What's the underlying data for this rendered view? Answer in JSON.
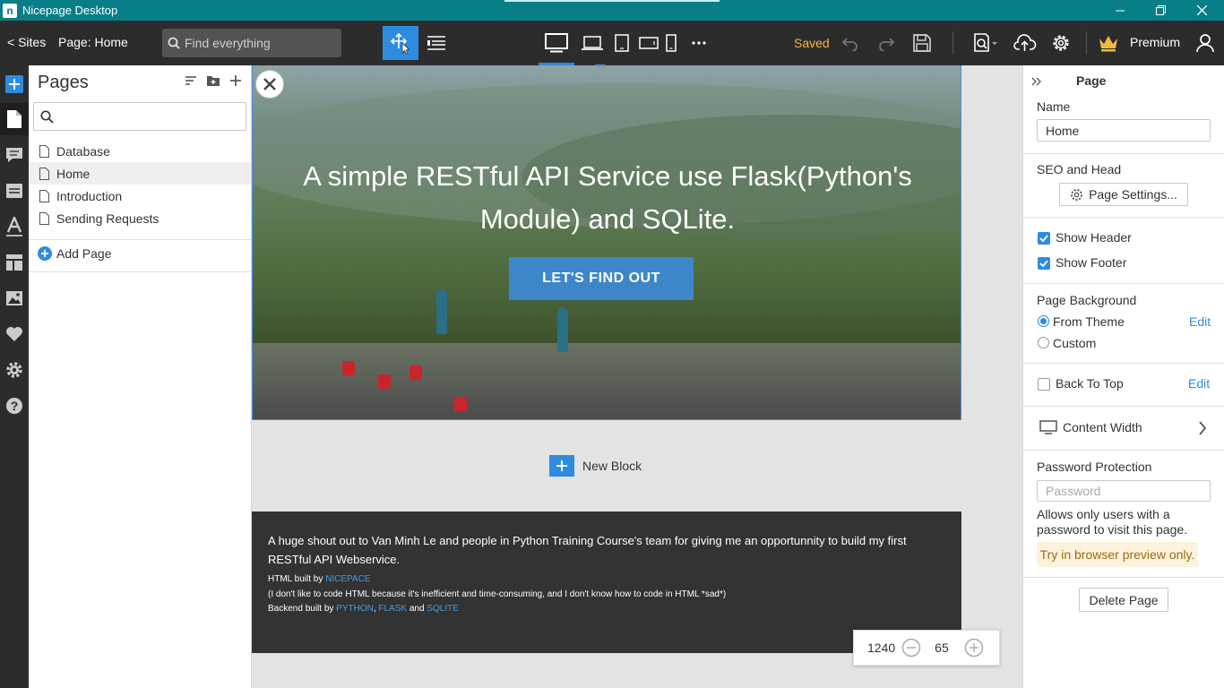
{
  "window": {
    "title": "Nicepage Desktop",
    "logo_letter": "n",
    "controls": [
      "minimize",
      "restore",
      "close"
    ]
  },
  "toolbar": {
    "back_label": "< Sites",
    "page_label": "Page: Home",
    "search_placeholder": "Find everything",
    "status": "Saved",
    "premium_label": "Premium",
    "colors": {
      "accent": "#2e8ce0",
      "status": "#f4b942",
      "titlebar": "#087f87"
    }
  },
  "rail": {
    "icons": [
      "add-icon",
      "pages-icon",
      "comments-icon",
      "blocks-icon",
      "typography-icon",
      "layout-icon",
      "images-icon",
      "favorites-icon",
      "settings-icon",
      "help-icon"
    ]
  },
  "pages_panel": {
    "title": "Pages",
    "items": [
      {
        "label": "Database",
        "selected": false
      },
      {
        "label": "Home",
        "selected": true
      },
      {
        "label": "Introduction",
        "selected": false
      },
      {
        "label": "Sending Requests",
        "selected": false
      }
    ],
    "add_page_label": "Add Page"
  },
  "canvas": {
    "hero_title": "A simple RESTful API Service use Flask(Python's Module) and SQLite.",
    "hero_button": "LET'S FIND OUT",
    "new_block_label": "New Block",
    "footer": {
      "main": "A huge shout out to Van Minh Le and people in Python Training Course's team for giving me an opportunnity to build my first RESTful API Webservice.",
      "html_prefix": "HTML built by ",
      "html_link": "NICEPACE",
      "note": "(I don't like to code HTML because it's inefficient and time-consuming, and I don't know  how to code in HTML *sad*)",
      "backend_prefix": "Backend built by ",
      "link_python": "PYTHON",
      "sep_comma": ", ",
      "link_flask": "FLASK",
      "sep_and": " and ",
      "link_sqlite": "SQLITE"
    },
    "zoom": {
      "width": "1240",
      "percent": "65"
    }
  },
  "properties": {
    "header": "Page",
    "name_label": "Name",
    "name_value": "Home",
    "seo_label": "SEO and Head",
    "page_settings_button": "Page Settings...",
    "show_header": {
      "label": "Show Header",
      "checked": true
    },
    "show_footer": {
      "label": "Show Footer",
      "checked": true
    },
    "background_label": "Page Background",
    "from_theme": {
      "label": "From Theme",
      "selected": true
    },
    "custom": {
      "label": "Custom",
      "selected": false
    },
    "edit_label": "Edit",
    "back_to_top": {
      "label": "Back To Top",
      "checked": false
    },
    "content_width_label": "Content Width",
    "password_label": "Password Protection",
    "password_placeholder": "Password",
    "password_hint": "Allows only users with a password to visit this page.",
    "browser_preview_note": "Try in browser preview only.",
    "delete_button": "Delete Page"
  }
}
